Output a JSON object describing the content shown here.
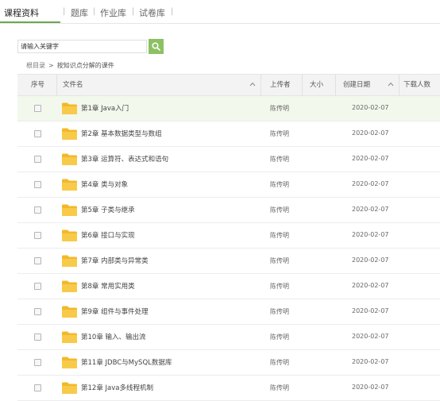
{
  "tabs": [
    {
      "label": "课程资料",
      "active": true
    },
    {
      "label": "题库",
      "active": false
    },
    {
      "label": "作业库",
      "active": false
    },
    {
      "label": "试卷库",
      "active": false
    }
  ],
  "tab_separator": "|",
  "search": {
    "value": "",
    "placeholder": "请输入关键字",
    "button_icon": "search-icon"
  },
  "breadcrumb": {
    "root": "根目录",
    "separator": ">",
    "current": "按知识点分解的课件"
  },
  "table": {
    "headers": {
      "index": "序号",
      "name": "文件名",
      "uploader": "上传者",
      "size": "大小",
      "created": "创建日期",
      "downloads": "下载人数"
    },
    "rows": [
      {
        "name": "第1章 Java入门",
        "uploader": "陈传明",
        "date": "2020-02-07",
        "size": "",
        "downloads": "",
        "highlighted": true
      },
      {
        "name": "第2章 基本数据类型与数组",
        "uploader": "陈传明",
        "date": "2020-02-07",
        "size": "",
        "downloads": "",
        "highlighted": false
      },
      {
        "name": "第3章 运算符、表达式和语句",
        "uploader": "陈传明",
        "date": "2020-02-07",
        "size": "",
        "downloads": "",
        "highlighted": false
      },
      {
        "name": "第4章 类与对象",
        "uploader": "陈传明",
        "date": "2020-02-07",
        "size": "",
        "downloads": "",
        "highlighted": false
      },
      {
        "name": "第5章 子类与继承",
        "uploader": "陈传明",
        "date": "2020-02-07",
        "size": "",
        "downloads": "",
        "highlighted": false
      },
      {
        "name": "第6章 接口与实现",
        "uploader": "陈传明",
        "date": "2020-02-07",
        "size": "",
        "downloads": "",
        "highlighted": false
      },
      {
        "name": "第7章 内部类与异常类",
        "uploader": "陈传明",
        "date": "2020-02-07",
        "size": "",
        "downloads": "",
        "highlighted": false
      },
      {
        "name": "第8章 常用实用类",
        "uploader": "陈传明",
        "date": "2020-02-07",
        "size": "",
        "downloads": "",
        "highlighted": false
      },
      {
        "name": "第9章 组件与事件处理",
        "uploader": "陈传明",
        "date": "2020-02-07",
        "size": "",
        "downloads": "",
        "highlighted": false
      },
      {
        "name": "第10章 输入、输出流",
        "uploader": "陈传明",
        "date": "2020-02-07",
        "size": "",
        "downloads": "",
        "highlighted": false
      },
      {
        "name": "第11章 JDBC与MySQL数据库",
        "uploader": "陈传明",
        "date": "2020-02-07",
        "size": "",
        "downloads": "",
        "highlighted": false
      },
      {
        "name": "第12章 Java多线程机制",
        "uploader": "陈传明",
        "date": "2020-02-07",
        "size": "",
        "downloads": "",
        "highlighted": false
      }
    ]
  },
  "colors": {
    "accent": "#8dc063",
    "folder": "#f6c33d",
    "row_highlight": "#f3f8ec",
    "header_bg": "#f3f3f3"
  }
}
